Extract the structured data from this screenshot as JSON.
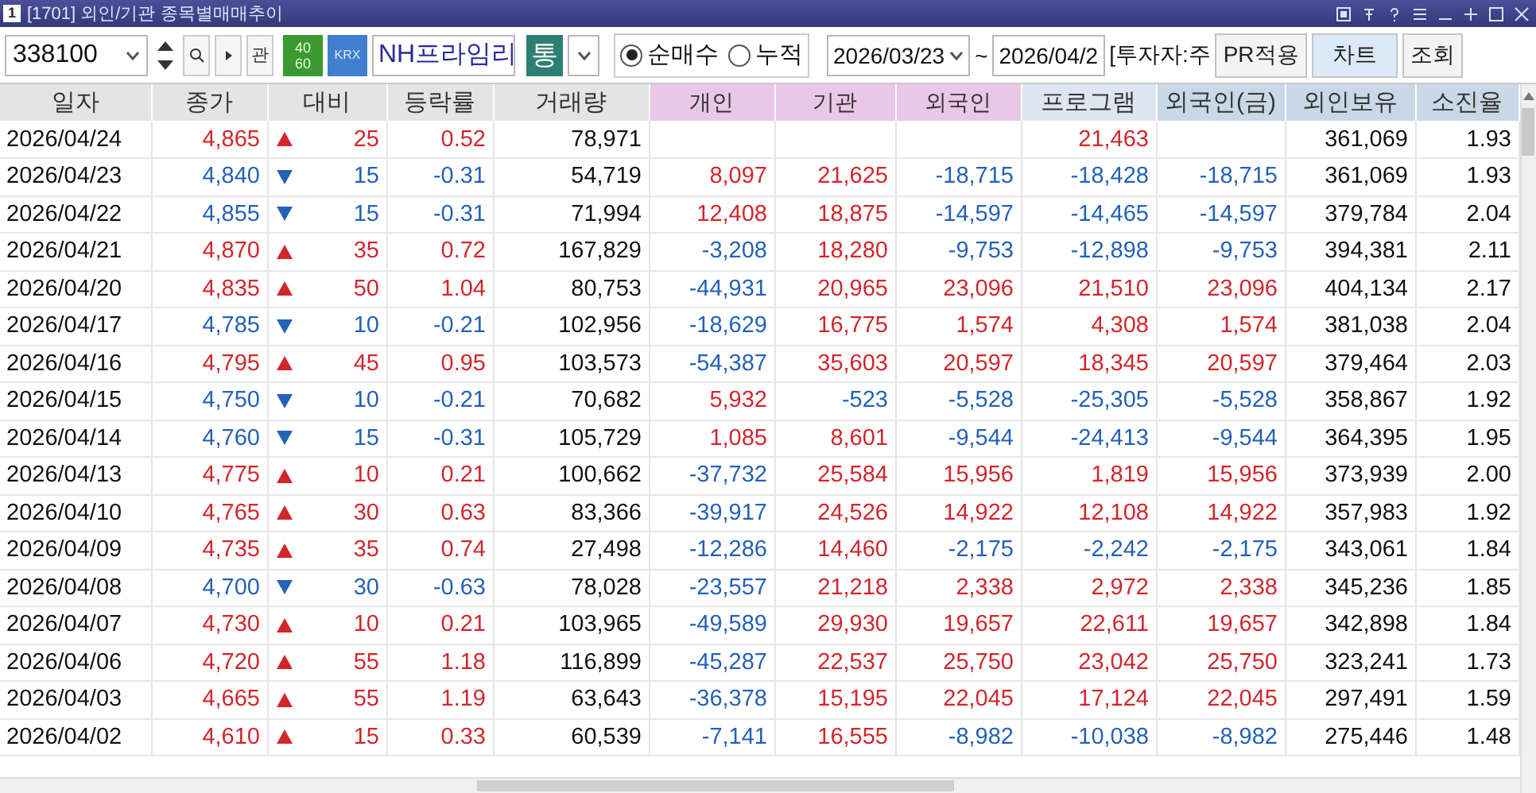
{
  "window": {
    "badge": "1",
    "title": "[1701] 외인/기관 종목별매매추이"
  },
  "toolbar": {
    "code": "338100",
    "related": "관",
    "market_ratio": [
      "40",
      "60"
    ],
    "exchange": "KRX",
    "stock_name": "NH프라임리",
    "type_button": "통",
    "modes": [
      {
        "label": "순매수",
        "selected": true
      },
      {
        "label": "누적",
        "selected": false
      }
    ],
    "date_from": "2026/03/23",
    "tilde": "~",
    "date_to": "2026/04/2",
    "investor": "[투자자:주",
    "buttons": [
      {
        "label": "PR적용",
        "kind": "plain"
      },
      {
        "label": "차트",
        "kind": "accent"
      },
      {
        "label": "조회",
        "kind": "plain"
      }
    ]
  },
  "table": {
    "columns": [
      {
        "label": "일자",
        "kind": "base"
      },
      {
        "label": "종가",
        "kind": "base"
      },
      {
        "label": "대비",
        "kind": "base"
      },
      {
        "label": "등락률",
        "kind": "base"
      },
      {
        "label": "거래량",
        "kind": "base"
      },
      {
        "label": "개인",
        "kind": "investor"
      },
      {
        "label": "기관",
        "kind": "investor"
      },
      {
        "label": "외국인",
        "kind": "investor"
      },
      {
        "label": "프로그램",
        "kind": "program"
      },
      {
        "label": "외국인(금)",
        "kind": "foreign"
      },
      {
        "label": "외인보유",
        "kind": "foreign"
      },
      {
        "label": "소진율",
        "kind": "foreign"
      }
    ],
    "rows": [
      {
        "date": "2026/04/24",
        "close": "4,865",
        "rising": true,
        "change": "25",
        "rate": "0.52",
        "volume": "78,971",
        "program": {
          "value": "21,463",
          "positive": true
        },
        "holding": "361,069",
        "exhaust": "1.93"
      },
      {
        "date": "2026/04/23",
        "close": "4,840",
        "rising": false,
        "change": "15",
        "rate": "-0.31",
        "volume": "54,719",
        "individual": {
          "value": "8,097",
          "positive": true
        },
        "institution": {
          "value": "21,625",
          "positive": true
        },
        "foreign": {
          "value": "-18,715",
          "positive": false
        },
        "program": {
          "value": "-18,428",
          "positive": false
        },
        "foreign_amount": {
          "value": "-18,715",
          "positive": false
        },
        "holding": "361,069",
        "exhaust": "1.93"
      },
      {
        "date": "2026/04/22",
        "close": "4,855",
        "rising": false,
        "change": "15",
        "rate": "-0.31",
        "volume": "71,994",
        "individual": {
          "value": "12,408",
          "positive": true
        },
        "institution": {
          "value": "18,875",
          "positive": true
        },
        "foreign": {
          "value": "-14,597",
          "positive": false
        },
        "program": {
          "value": "-14,465",
          "positive": false
        },
        "foreign_amount": {
          "value": "-14,597",
          "positive": false
        },
        "holding": "379,784",
        "exhaust": "2.04"
      },
      {
        "date": "2026/04/21",
        "close": "4,870",
        "rising": true,
        "change": "35",
        "rate": "0.72",
        "volume": "167,829",
        "individual": {
          "value": "-3,208",
          "positive": false
        },
        "institution": {
          "value": "18,280",
          "positive": true
        },
        "foreign": {
          "value": "-9,753",
          "positive": false
        },
        "program": {
          "value": "-12,898",
          "positive": false
        },
        "foreign_amount": {
          "value": "-9,753",
          "positive": false
        },
        "holding": "394,381",
        "exhaust": "2.11"
      },
      {
        "date": "2026/04/20",
        "close": "4,835",
        "rising": true,
        "change": "50",
        "rate": "1.04",
        "volume": "80,753",
        "individual": {
          "value": "-44,931",
          "positive": false
        },
        "institution": {
          "value": "20,965",
          "positive": true
        },
        "foreign": {
          "value": "23,096",
          "positive": true
        },
        "program": {
          "value": "21,510",
          "positive": true
        },
        "foreign_amount": {
          "value": "23,096",
          "positive": true
        },
        "holding": "404,134",
        "exhaust": "2.17"
      },
      {
        "date": "2026/04/17",
        "close": "4,785",
        "rising": false,
        "change": "10",
        "rate": "-0.21",
        "volume": "102,956",
        "individual": {
          "value": "-18,629",
          "positive": false
        },
        "institution": {
          "value": "16,775",
          "positive": true
        },
        "foreign": {
          "value": "1,574",
          "positive": true
        },
        "program": {
          "value": "4,308",
          "positive": true
        },
        "foreign_amount": {
          "value": "1,574",
          "positive": true
        },
        "holding": "381,038",
        "exhaust": "2.04"
      },
      {
        "date": "2026/04/16",
        "close": "4,795",
        "rising": true,
        "change": "45",
        "rate": "0.95",
        "volume": "103,573",
        "individual": {
          "value": "-54,387",
          "positive": false
        },
        "institution": {
          "value": "35,603",
          "positive": true
        },
        "foreign": {
          "value": "20,597",
          "positive": true
        },
        "program": {
          "value": "18,345",
          "positive": true
        },
        "foreign_amount": {
          "value": "20,597",
          "positive": true
        },
        "holding": "379,464",
        "exhaust": "2.03"
      },
      {
        "date": "2026/04/15",
        "close": "4,750",
        "rising": false,
        "change": "10",
        "rate": "-0.21",
        "volume": "70,682",
        "individual": {
          "value": "5,932",
          "positive": true
        },
        "institution": {
          "value": "-523",
          "positive": false
        },
        "foreign": {
          "value": "-5,528",
          "positive": false
        },
        "program": {
          "value": "-25,305",
          "positive": false
        },
        "foreign_amount": {
          "value": "-5,528",
          "positive": false
        },
        "holding": "358,867",
        "exhaust": "1.92"
      },
      {
        "date": "2026/04/14",
        "close": "4,760",
        "rising": false,
        "change": "15",
        "rate": "-0.31",
        "volume": "105,729",
        "individual": {
          "value": "1,085",
          "positive": true
        },
        "institution": {
          "value": "8,601",
          "positive": true
        },
        "foreign": {
          "value": "-9,544",
          "positive": false
        },
        "program": {
          "value": "-24,413",
          "positive": false
        },
        "foreign_amount": {
          "value": "-9,544",
          "positive": false
        },
        "holding": "364,395",
        "exhaust": "1.95"
      },
      {
        "date": "2026/04/13",
        "close": "4,775",
        "rising": true,
        "change": "10",
        "rate": "0.21",
        "volume": "100,662",
        "individual": {
          "value": "-37,732",
          "positive": false
        },
        "institution": {
          "value": "25,584",
          "positive": true
        },
        "foreign": {
          "value": "15,956",
          "positive": true
        },
        "program": {
          "value": "1,819",
          "positive": true
        },
        "foreign_amount": {
          "value": "15,956",
          "positive": true
        },
        "holding": "373,939",
        "exhaust": "2.00"
      },
      {
        "date": "2026/04/10",
        "close": "4,765",
        "rising": true,
        "change": "30",
        "rate": "0.63",
        "volume": "83,366",
        "individual": {
          "value": "-39,917",
          "positive": false
        },
        "institution": {
          "value": "24,526",
          "positive": true
        },
        "foreign": {
          "value": "14,922",
          "positive": true
        },
        "program": {
          "value": "12,108",
          "positive": true
        },
        "foreign_amount": {
          "value": "14,922",
          "positive": true
        },
        "holding": "357,983",
        "exhaust": "1.92"
      },
      {
        "date": "2026/04/09",
        "close": "4,735",
        "rising": true,
        "change": "35",
        "rate": "0.74",
        "volume": "27,498",
        "individual": {
          "value": "-12,286",
          "positive": false
        },
        "institution": {
          "value": "14,460",
          "positive": true
        },
        "foreign": {
          "value": "-2,175",
          "positive": false
        },
        "program": {
          "value": "-2,242",
          "positive": false
        },
        "foreign_amount": {
          "value": "-2,175",
          "positive": false
        },
        "holding": "343,061",
        "exhaust": "1.84"
      },
      {
        "date": "2026/04/08",
        "close": "4,700",
        "rising": false,
        "change": "30",
        "rate": "-0.63",
        "volume": "78,028",
        "individual": {
          "value": "-23,557",
          "positive": false
        },
        "institution": {
          "value": "21,218",
          "positive": true
        },
        "foreign": {
          "value": "2,338",
          "positive": true
        },
        "program": {
          "value": "2,972",
          "positive": true
        },
        "foreign_amount": {
          "value": "2,338",
          "positive": true
        },
        "holding": "345,236",
        "exhaust": "1.85"
      },
      {
        "date": "2026/04/07",
        "close": "4,730",
        "rising": true,
        "change": "10",
        "rate": "0.21",
        "volume": "103,965",
        "individual": {
          "value": "-49,589",
          "positive": false
        },
        "institution": {
          "value": "29,930",
          "positive": true
        },
        "foreign": {
          "value": "19,657",
          "positive": true
        },
        "program": {
          "value": "22,611",
          "positive": true
        },
        "foreign_amount": {
          "value": "19,657",
          "positive": true
        },
        "holding": "342,898",
        "exhaust": "1.84"
      },
      {
        "date": "2026/04/06",
        "close": "4,720",
        "rising": true,
        "change": "55",
        "rate": "1.18",
        "volume": "116,899",
        "individual": {
          "value": "-45,287",
          "positive": false
        },
        "institution": {
          "value": "22,537",
          "positive": true
        },
        "foreign": {
          "value": "25,750",
          "positive": true
        },
        "program": {
          "value": "23,042",
          "positive": true
        },
        "foreign_amount": {
          "value": "25,750",
          "positive": true
        },
        "holding": "323,241",
        "exhaust": "1.73"
      },
      {
        "date": "2026/04/03",
        "close": "4,665",
        "rising": true,
        "change": "55",
        "rate": "1.19",
        "volume": "63,643",
        "individual": {
          "value": "-36,378",
          "positive": false
        },
        "institution": {
          "value": "15,195",
          "positive": true
        },
        "foreign": {
          "value": "22,045",
          "positive": true
        },
        "program": {
          "value": "17,124",
          "positive": true
        },
        "foreign_amount": {
          "value": "22,045",
          "positive": true
        },
        "holding": "297,491",
        "exhaust": "1.59"
      },
      {
        "date": "2026/04/02",
        "close": "4,610",
        "rising": true,
        "change": "15",
        "rate": "0.33",
        "volume": "60,539",
        "individual": {
          "value": "-7,141",
          "positive": false
        },
        "institution": {
          "value": "16,555",
          "positive": true
        },
        "foreign": {
          "value": "-8,982",
          "positive": false
        },
        "program": {
          "value": "-10,038",
          "positive": false
        },
        "foreign_amount": {
          "value": "-8,982",
          "positive": false
        },
        "holding": "275,446",
        "exhaust": "1.48"
      }
    ]
  }
}
